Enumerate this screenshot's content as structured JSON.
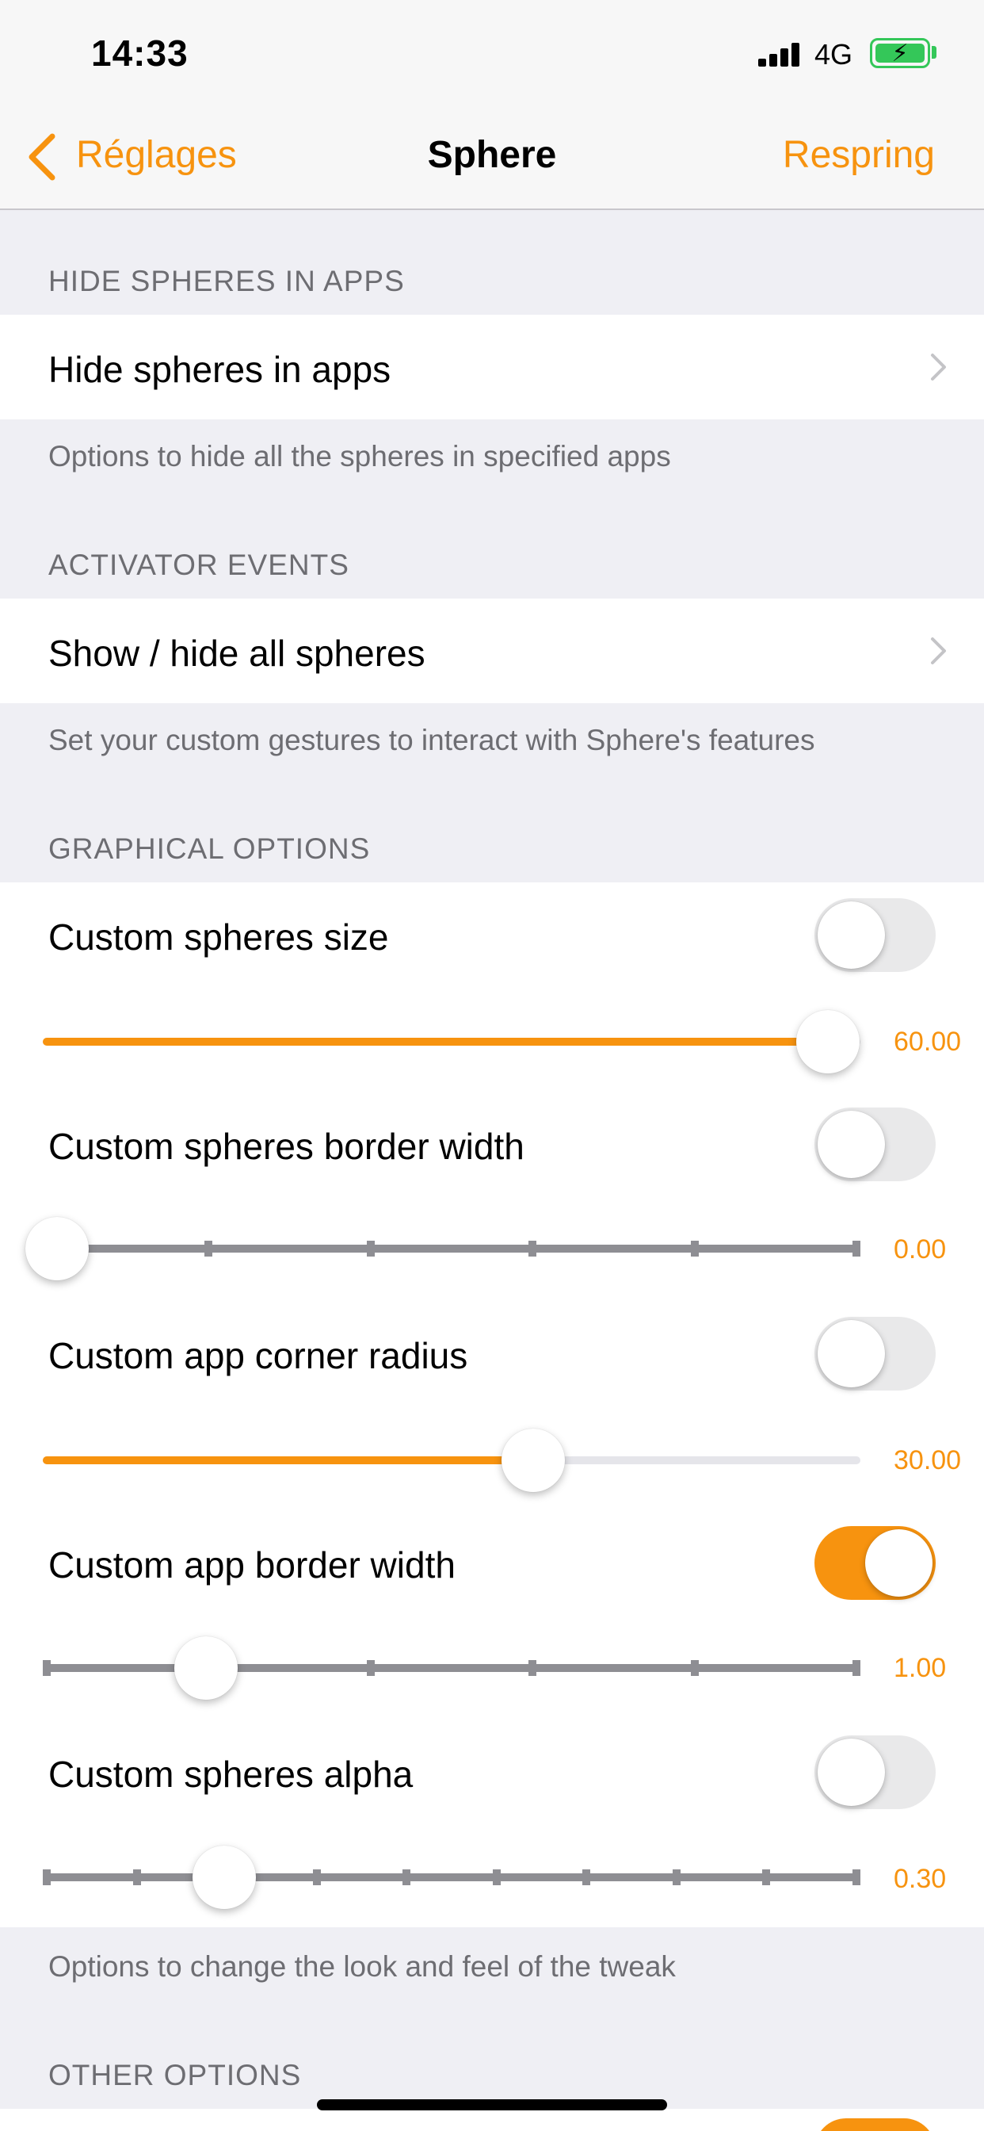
{
  "status_bar": {
    "time": "14:33",
    "network": "4G"
  },
  "nav": {
    "back_label": "Réglages",
    "title": "Sphere",
    "action_label": "Respring"
  },
  "sections": {
    "hide": {
      "header": "HIDE SPHERES IN APPS",
      "row_label": "Hide spheres in apps",
      "footer": "Options to hide all the spheres in specified apps"
    },
    "activator": {
      "header": "ACTIVATOR EVENTS",
      "row_label": "Show / hide all spheres",
      "footer": "Set your custom gestures to interact with Sphere's features"
    },
    "graphical": {
      "header": "GRAPHICAL OPTIONS",
      "footer": "Options to change the look and feel of the tweak",
      "items": [
        {
          "label": "Custom spheres size",
          "toggle_on": false,
          "slider_fraction": 0.96,
          "value": "60.00"
        },
        {
          "label": "Custom spheres border width",
          "toggle_on": false,
          "slider_fraction": 0.0,
          "value": "0.00"
        },
        {
          "label": "Custom app corner radius",
          "toggle_on": false,
          "slider_fraction": 0.6,
          "value": "30.00"
        },
        {
          "label": "Custom app border width",
          "toggle_on": true,
          "slider_fraction": 0.2,
          "value": "1.00"
        },
        {
          "label": "Custom spheres alpha",
          "toggle_on": false,
          "slider_fraction": 0.222,
          "value": "0.30"
        }
      ]
    },
    "other": {
      "header": "OTHER OPTIONS"
    }
  },
  "colors": {
    "accent": "#f7930f",
    "toggle_off": "#e9e9ea",
    "battery": "#34c759"
  }
}
